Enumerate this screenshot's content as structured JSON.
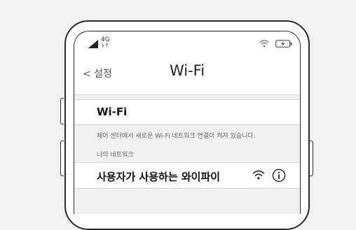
{
  "status_bar": {
    "network_type": "4G",
    "network_arrows": "↓↑"
  },
  "nav": {
    "back_label": "< 설정",
    "title": "Wi-Fi"
  },
  "wifi_toggle": {
    "label": "Wi-Fi"
  },
  "control_center_note": "제어 센터에서 새로운 Wi-Fi 네트워크 연결이 켜져 있습니다.",
  "my_networks": {
    "header": "나의 네트워크",
    "items": [
      {
        "name": "사용자가 사용하는 와이파이",
        "icons": [
          "wifi-icon",
          "info-icon"
        ]
      }
    ]
  }
}
